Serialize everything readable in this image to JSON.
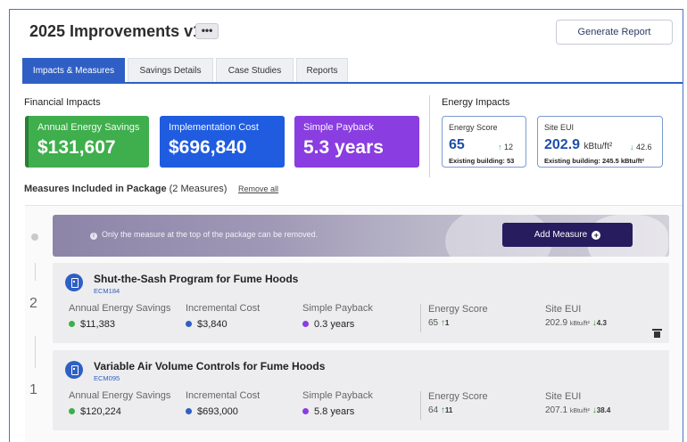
{
  "header": {
    "title": "2025 Improvements v1",
    "more_label": "•••",
    "generate_report_label": "Generate Report"
  },
  "tabs": [
    {
      "label": "Impacts & Measures",
      "active": true
    },
    {
      "label": "Savings Details",
      "active": false
    },
    {
      "label": "Case Studies",
      "active": false
    },
    {
      "label": "Reports",
      "active": false
    }
  ],
  "financial": {
    "section_label": "Financial Impacts",
    "cards": [
      {
        "label": "Annual Energy Savings",
        "value": "$131,607",
        "color": "#3fae4c"
      },
      {
        "label": "Implementation Cost",
        "value": "$696,840",
        "color": "#1f5ce0"
      },
      {
        "label": "Simple Payback",
        "value": "5.3 years",
        "color": "#8a3de0"
      }
    ]
  },
  "energy": {
    "section_label": "Energy Impacts",
    "score": {
      "label": "Energy Score",
      "value": "65",
      "change_arrow": "↑",
      "change": "12",
      "existing": "Existing building: 53"
    },
    "eui": {
      "label": "Site EUI",
      "value": "202.9",
      "unit": "kBtu/ft²",
      "change_arrow": "↓",
      "change": "42.6",
      "existing": "Existing building: 245.5 kBtu/ft²"
    }
  },
  "measures_section": {
    "title": "Measures Included in Package",
    "count": "(2 Measures)",
    "remove_all_label": "Remove all"
  },
  "banner": {
    "info_text": "Only the measure at the top of the package can be removed.",
    "add_measure_label": "Add Measure"
  },
  "measures": [
    {
      "number": "2",
      "name": "Shut-the-Sash Program for Fume Hoods",
      "code": "ECM184",
      "savings_label": "Annual Energy Savings",
      "savings": "$11,383",
      "cost_label": "Incremental Cost",
      "cost": "$3,840",
      "payback_label": "Simple Payback",
      "payback": "0.3 years",
      "score_label": "Energy Score",
      "score": "65",
      "score_arrow": "↑",
      "score_change": "1",
      "eui_label": "Site EUI",
      "eui": "202.9",
      "eui_unit": "kBtu/ft²",
      "eui_arrow": "↓",
      "eui_change": "4.3"
    },
    {
      "number": "1",
      "name": "Variable Air Volume Controls for Fume Hoods",
      "code": "ECM095",
      "savings_label": "Annual Energy Savings",
      "savings": "$120,224",
      "cost_label": "Incremental Cost",
      "cost": "$693,000",
      "payback_label": "Simple Payback",
      "payback": "5.8 years",
      "score_label": "Energy Score",
      "score": "64",
      "score_arrow": "↑",
      "score_change": "11",
      "eui_label": "Site EUI",
      "eui": "207.1",
      "eui_unit": "kBtu/ft²",
      "eui_arrow": "↓",
      "eui_change": "38.4"
    }
  ],
  "colors": {
    "accent": "#2f5fc4",
    "savings_dot": "#3fae4c",
    "cost_dot": "#2f5fc4",
    "payback_dot": "#8a3de0",
    "add_button": "#261c5e"
  }
}
